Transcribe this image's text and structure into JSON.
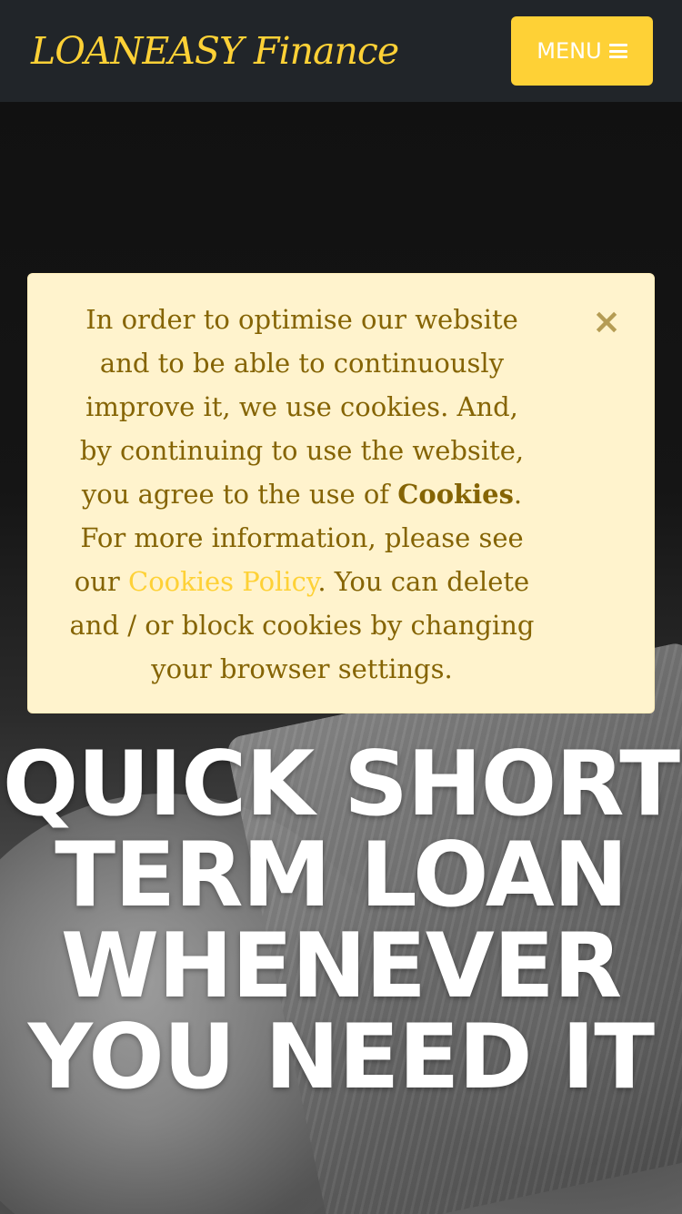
{
  "header": {
    "brand": "LOANEASY Finance",
    "menu_label": "MENU",
    "menu_icon": "bars-icon"
  },
  "cookie_notice": {
    "text_1": "In order to optimise our website and to be able to continuously improve it, we use cookies. And, by continuing to use the website, you agree to the use of ",
    "bold": "Cookies",
    "text_2": ". For more information, please see our ",
    "link": "Cookies Policy",
    "text_3": ". You can delete and / or block cookies by changing your browser settings.",
    "close_glyph": "×",
    "colors": {
      "background": "#fff3cd",
      "text": "#856404",
      "link": "#fed136"
    }
  },
  "hero": {
    "title": "QUICK SHORT TERM LOAN WHENEVER YOU NEED IT"
  },
  "colors": {
    "navbar": "#212529",
    "accent": "#fed136",
    "hero_text": "#ffffff"
  }
}
